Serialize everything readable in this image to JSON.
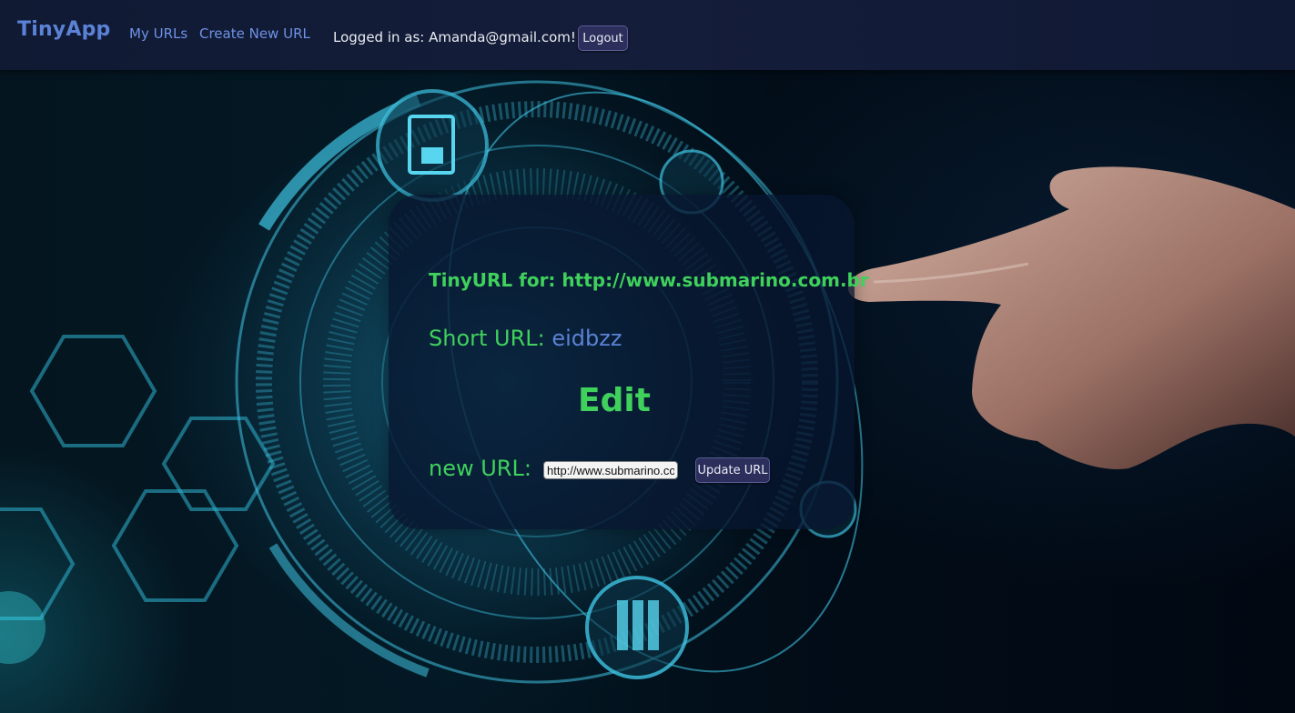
{
  "navbar": {
    "brand": "TinyApp",
    "links": {
      "my_urls": "My URLs",
      "create_new_url": "Create New URL"
    },
    "logged_in_text": "Logged in as: Amanda@gmail.com!",
    "logout_label": "Logout"
  },
  "card": {
    "tinyurl_prefix": "TinyURL for: ",
    "long_url": "http://www.submarino.com.br",
    "short_url_label": "Short URL: ",
    "short_url_code": "eidbzz",
    "edit_heading": "Edit",
    "new_url_label": "new URL:",
    "new_url_value": "http://www.submarino.com.br",
    "update_button_label": "Update URL"
  },
  "colors": {
    "accent_green": "#3fd15c",
    "link_blue": "#5b82d6",
    "navbar_bg": "#141d3a",
    "button_bg": "#2c2e5c"
  },
  "background": {
    "description_icon_names": [
      "circuit-ring-graphic",
      "lock-document-icon",
      "document-icon",
      "folder-icon",
      "hexagon-grid-graphic",
      "pointing-hand-graphic"
    ]
  }
}
